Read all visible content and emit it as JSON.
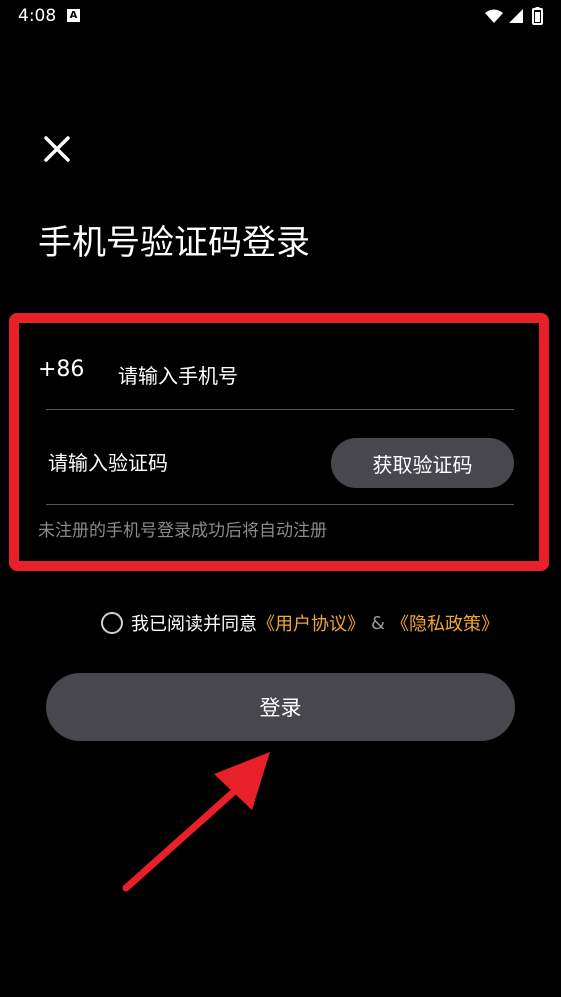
{
  "status_bar": {
    "time": "4:08",
    "notification_badge": "A"
  },
  "header": {
    "title": "手机号验证码登录"
  },
  "form": {
    "country_code": "+86",
    "phone_placeholder": "请输入手机号",
    "code_placeholder": "请输入验证码",
    "get_code_label": "获取验证码",
    "hint": "未注册的手机号登录成功后将自动注册"
  },
  "agreement": {
    "prefix": "我已阅读并同意",
    "user_agreement": "《用户协议》",
    "separator": "&",
    "privacy_policy": "《隐私政策》"
  },
  "login": {
    "label": "登录"
  },
  "colors": {
    "highlight": "#e8202a",
    "link": "#f2a634",
    "button": "#48474d"
  }
}
